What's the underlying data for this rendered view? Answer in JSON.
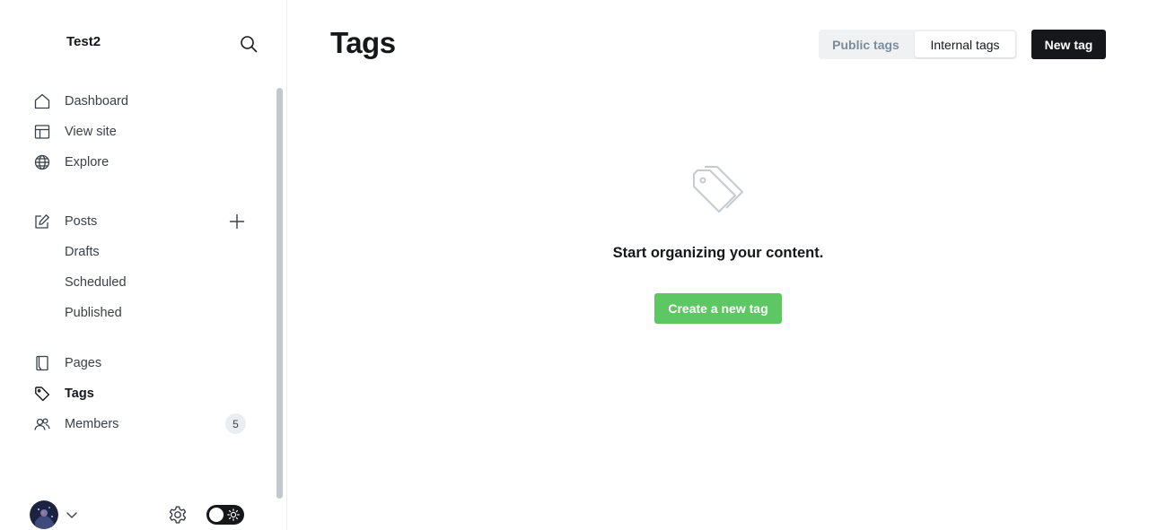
{
  "sidebar": {
    "site_title": "Test2",
    "nav": [
      {
        "label": "Dashboard",
        "icon": "home-icon"
      },
      {
        "label": "View site",
        "icon": "layout-icon"
      },
      {
        "label": "Explore",
        "icon": "globe-icon"
      }
    ],
    "posts": {
      "label": "Posts",
      "icon": "edit-icon",
      "sub_items": [
        "Drafts",
        "Scheduled",
        "Published"
      ]
    },
    "nav2": [
      {
        "label": "Pages",
        "icon": "page-icon"
      },
      {
        "label": "Tags",
        "icon": "tag-icon",
        "active": true
      },
      {
        "label": "Members",
        "icon": "members-icon",
        "badge": "5"
      }
    ]
  },
  "header": {
    "title": "Tags",
    "tabs": [
      "Public tags",
      "Internal tags"
    ],
    "active_tab": "Internal tags",
    "new_button": "New tag"
  },
  "empty_state": {
    "message": "Start organizing your content.",
    "button": "Create a new tag"
  },
  "colors": {
    "accent_green": "#5cc763",
    "dark": "#15171a",
    "segment_bg": "#eff1f3"
  }
}
